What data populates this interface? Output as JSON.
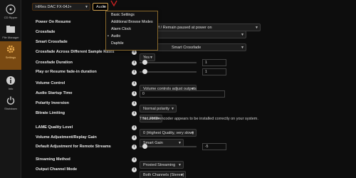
{
  "sidebar": {
    "items": [
      {
        "label": "CD Ripper",
        "icon": "cd-icon"
      },
      {
        "label": "File Manager",
        "icon": "folder-icon"
      },
      {
        "label": "Settings",
        "icon": "gear-icon"
      },
      {
        "label": "Info",
        "icon": "info-icon"
      },
      {
        "label": "Shutdown",
        "icon": "power-icon"
      }
    ]
  },
  "topbar": {
    "device": "HiRes DAC FX-04J+",
    "section": "Audio"
  },
  "menu": {
    "items": [
      "Basic Settings",
      "Additional Browse Modes",
      "Alarm Clock",
      "Audio",
      "Daphile"
    ],
    "selected": "Audio"
  },
  "settings": {
    "power_on_resume": {
      "label": "Power On Resume",
      "value": "Power off / Remain paused at power on"
    },
    "crossfade": {
      "label": "Crossfade",
      "value": ""
    },
    "smart_crossfade": {
      "label": "Smart Crossfade",
      "value": "Smart Crossfade"
    },
    "crossfade_across": {
      "label": "Crossfade Across Different Sample Rates",
      "value": "Yes"
    },
    "crossfade_duration": {
      "label": "Crossfade Duration",
      "value": "1"
    },
    "play_resume_fade": {
      "label": "Play or Resume fade-in duration",
      "value": "1"
    },
    "volume_control": {
      "label": "Volume Control",
      "value": "Volume controls adjust outputs"
    },
    "audio_startup": {
      "label": "Audio Startup Time",
      "value": "0"
    },
    "polarity": {
      "label": "Polarity Inversion",
      "value": "Normal polarity"
    },
    "bitrate": {
      "label": "Bitrate Limiting",
      "value": "No Limit",
      "note": "The LAME encoder appears to be installed correctly on your system."
    },
    "lame_quality": {
      "label": "LAME Quality Level",
      "value": "0 (Highest Quality, very slow)"
    },
    "volume_adjust": {
      "label": "Volume Adjustment/Replay Gain",
      "value": "Smart Gain"
    },
    "default_adjust": {
      "label": "Default Adjustment for Remote Streams",
      "value": "-5"
    },
    "streaming_method": {
      "label": "Streaming Method",
      "value": "Proxied Streaming"
    },
    "output_channel": {
      "label": "Output Channel Mode",
      "value": "Both Channels (Stereo)"
    }
  },
  "sliders": {
    "crossfade_duration": 0.05,
    "play_resume_fade": 0.05,
    "default_adjust": 0.05
  },
  "colors": {
    "accent": "#7a4a12",
    "background": "#0d0d0d",
    "arrow": "#cc2222"
  }
}
